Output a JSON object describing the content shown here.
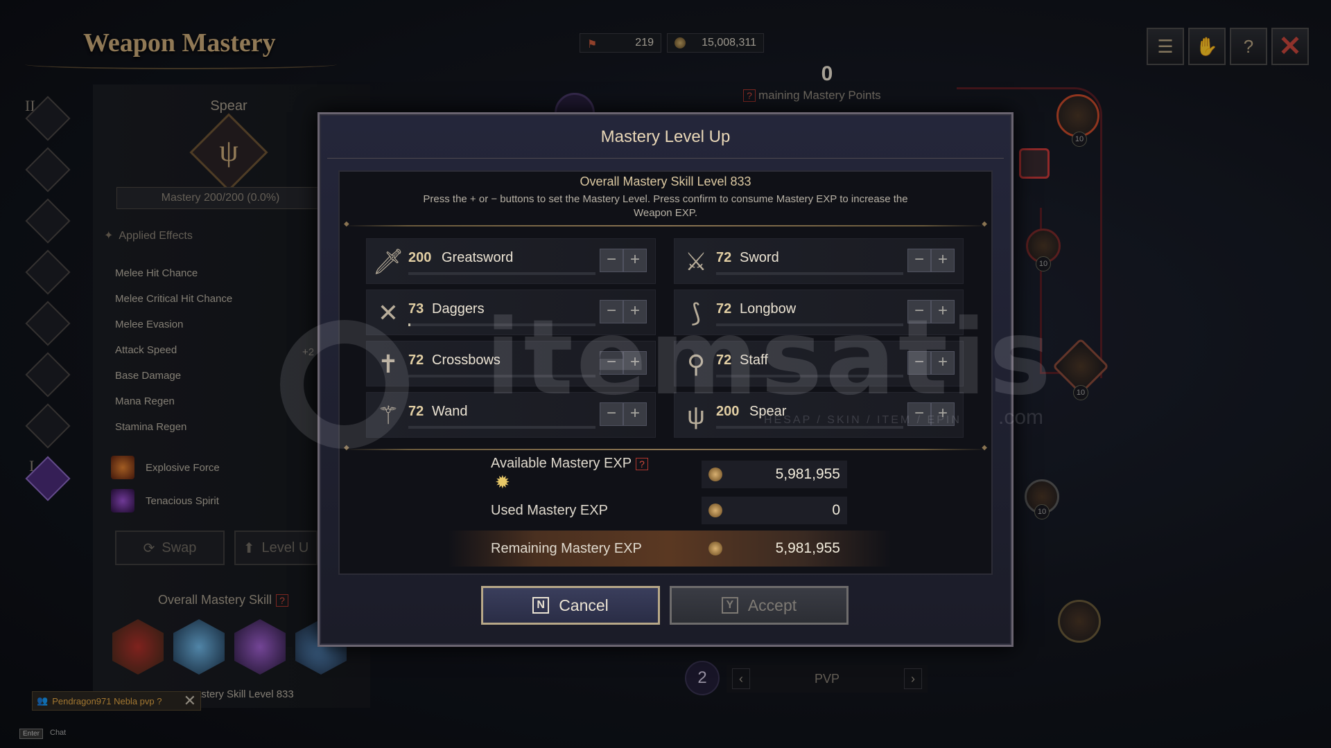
{
  "header": {
    "title": "Weapon Mastery",
    "currency_1": "219",
    "currency_2": "15,008,311",
    "mastery_points": "0",
    "mastery_points_label": "maining Mastery Points"
  },
  "left_panel": {
    "rail_numerals": [
      "II",
      "I"
    ],
    "weapon_name": "Spear",
    "mastery_progress": "Mastery 200/200 (0.0%)",
    "applied_effects_title": "Applied Effects",
    "effects": [
      "Melee Hit Chance",
      "Melee Critical Hit Chance",
      "Melee Evasion",
      "Attack Speed",
      "Base Damage",
      "Mana Regen",
      "Stamina Regen"
    ],
    "effect_partial_value": "+2",
    "skills": [
      "Explosive Force",
      "Tenacious Spirit"
    ],
    "swap_label": "Swap",
    "level_up_label": "Level U",
    "overall_skill_label": "Overall Mastery Skill",
    "overall_skill_level_text": "astery Skill Level 833"
  },
  "chat": {
    "message": "Pendragon971  Nebla pvp ?",
    "enter_key": "Enter",
    "chat_label": "Chat"
  },
  "tree": {
    "node_level": "10",
    "pvp_label": "PVP",
    "page_number": "2"
  },
  "modal": {
    "title": "Mastery Level Up",
    "overall_level": "Overall Mastery Skill Level 833",
    "instructions": "Press the + or − buttons to set the Mastery Level. Press confirm to consume Mastery EXP to increase the Weapon EXP.",
    "weapons": [
      {
        "level": "200",
        "name": "Greatsword",
        "icon": "greatsword-icon",
        "glyph": "🗡",
        "progress": 0.0
      },
      {
        "level": "72",
        "name": "Sword",
        "icon": "sword-icon",
        "glyph": "⚔",
        "progress": 0.0
      },
      {
        "level": "73",
        "name": "Daggers",
        "icon": "daggers-icon",
        "glyph": "✕",
        "progress": 0.01
      },
      {
        "level": "72",
        "name": "Longbow",
        "icon": "longbow-icon",
        "glyph": "⟆",
        "progress": 0.0
      },
      {
        "level": "72",
        "name": "Crossbows",
        "icon": "crossbow-icon",
        "glyph": "✝",
        "progress": 0.0
      },
      {
        "level": "72",
        "name": "Staff",
        "icon": "staff-icon",
        "glyph": "⚲",
        "progress": 0.0
      },
      {
        "level": "72",
        "name": "Wand",
        "icon": "wand-icon",
        "glyph": "⚚",
        "progress": 0.0
      },
      {
        "level": "200",
        "name": "Spear",
        "icon": "spear-icon",
        "glyph": "ψ",
        "progress": 0.0
      }
    ],
    "minus_symbol": "−",
    "plus_symbol": "+",
    "available_exp_label": "Available Mastery EXP",
    "available_exp_value": "5,981,955",
    "used_exp_label": "Used Mastery EXP",
    "used_exp_value": "0",
    "remaining_exp_label": "Remaining Mastery EXP",
    "remaining_exp_value": "5,981,955",
    "help_mark": "?",
    "cancel_key": "N",
    "cancel_label": "Cancel",
    "accept_key": "Y",
    "accept_label": "Accept"
  },
  "watermark": {
    "brand": "itemsatis",
    "tagline": "HESAP / SKIN / ITEM / EPIN",
    "domain": ".com"
  },
  "colors": {
    "gold_text": "#e2cfa4",
    "cancel_border": "#b8a888",
    "help_red": "#d24a3c",
    "tree_line_red": "#5a1e24"
  }
}
